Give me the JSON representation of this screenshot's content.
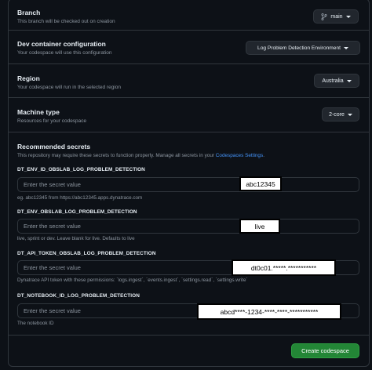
{
  "branch": {
    "title": "Branch",
    "description": "This branch will be checked out on creation",
    "selected": "main"
  },
  "devcontainer": {
    "title": "Dev container configuration",
    "description": "Your codespace will use this configuration",
    "selected": "Log Problem Detection Environment"
  },
  "region": {
    "title": "Region",
    "description": "Your codespace will run in the selected region",
    "selected": "Australia"
  },
  "machine": {
    "title": "Machine type",
    "description": "Resources for your codespace",
    "selected": "2-core"
  },
  "secrets": {
    "title": "Recommended secrets",
    "description_prefix": "This repository may require these secrets to function properly. Manage all secrets in your ",
    "description_link": "Codespaces Settings",
    "description_suffix": ".",
    "items": [
      {
        "name": "DT_ENV_ID_OBSLAB_LOG_PROBLEM_DETECTION",
        "placeholder": "Enter the secret value",
        "help": "eg. abc12345 from https://abc12345.apps.dynatrace.com",
        "annotation": "abc12345"
      },
      {
        "name": "DT_ENV_OBSLAB_LOG_PROBLEM_DETECTION",
        "placeholder": "Enter the secret value",
        "help": "live, sprint or dev. Leave blank for live. Defaults to live",
        "annotation": "live"
      },
      {
        "name": "DT_API_TOKEN_OBSLAB_LOG_PROBLEM_DETECTION",
        "placeholder": "Enter the secret value",
        "help": "Dynatrace API token with these permissions: `logs.ingest`, `events.ingest`, `settings.read`, `settings.write`",
        "annotation": "dt0c01.*****.***********"
      },
      {
        "name": "DT_NOTEBOOK_ID_LOG_PROBLEM_DETECTION",
        "placeholder": "Enter the secret value",
        "help": "The notebook ID",
        "annotation": "abcd****-1234-****-****-***********"
      }
    ]
  },
  "create_button": "Create codespace"
}
